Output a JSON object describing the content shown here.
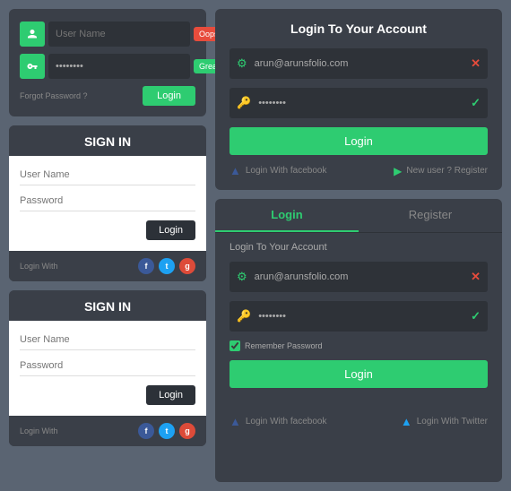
{
  "left": {
    "card1": {
      "username_placeholder": "User Name",
      "badge_oops": "Oops !",
      "badge_great": "Great",
      "forgot_label": "Forgot Password ?",
      "login_btn": "Login"
    },
    "card2": {
      "title": "SIGN IN",
      "username_label": "User Name",
      "password_label": "Password",
      "login_btn": "Login",
      "login_with": "Login With"
    },
    "card3": {
      "title": "SIGN IN",
      "username_label": "User Name",
      "password_label": "Password",
      "login_btn": "Login",
      "login_with": "Login With"
    }
  },
  "right": {
    "top": {
      "title": "Login To Your Account",
      "email_value": "arun@arunsfolio.com",
      "password_dots": "••••••••",
      "login_btn": "Login",
      "facebook_label": "Login With facebook",
      "register_label": "New user ? Register"
    },
    "bottom": {
      "tab_login": "Login",
      "tab_register": "Register",
      "subtitle": "Login To Your Account",
      "email_value": "arun@arunsfolio.com",
      "password_dots": "••••••••",
      "remember_label": "Remember Password",
      "login_btn": "Login",
      "facebook_label": "Login With facebook",
      "twitter_label": "Login With Twitter"
    }
  }
}
